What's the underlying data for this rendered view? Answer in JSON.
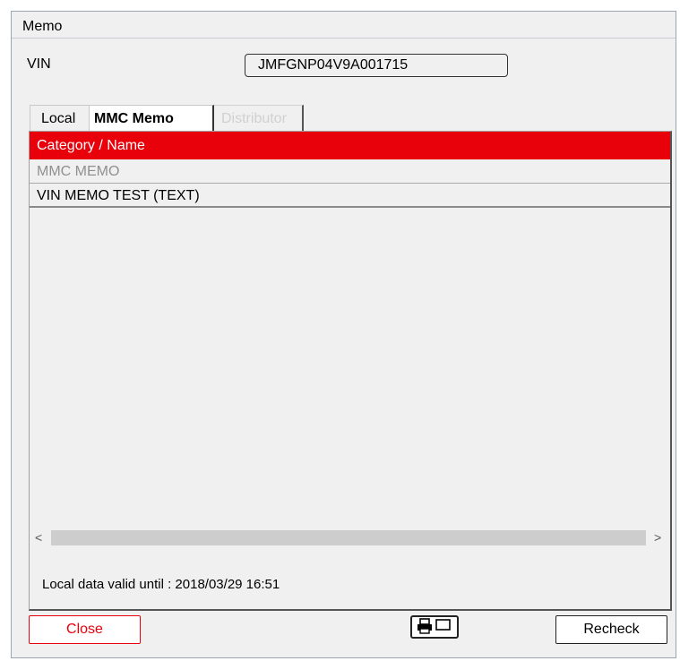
{
  "window": {
    "title": "Memo"
  },
  "vin": {
    "label": "VIN",
    "value": "JMFGNP04V9A001715"
  },
  "tabs": [
    {
      "label": "Local",
      "state": "normal"
    },
    {
      "label": "MMC Memo",
      "state": "selected"
    },
    {
      "label": "Distributor",
      "state": "disabled"
    }
  ],
  "list": {
    "header": "Category / Name",
    "rows": [
      {
        "label": "MMC MEMO",
        "type": "category"
      },
      {
        "label": "VIN MEMO TEST (TEXT)",
        "type": "item"
      }
    ]
  },
  "scrollbar": {
    "left_arrow": "<",
    "right_arrow": ">"
  },
  "status": {
    "valid_until": "Local data valid until : 2018/03/29 16:51"
  },
  "buttons": {
    "close": "Close",
    "print_icon": "printer-screen-icon",
    "recheck": "Recheck"
  },
  "colors": {
    "accent": "#e8000b",
    "background": "#f0f0f0"
  }
}
